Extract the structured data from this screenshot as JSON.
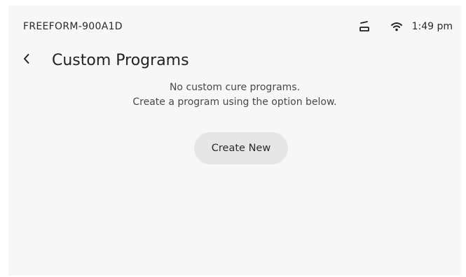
{
  "status_bar": {
    "device_name": "FREEFORM-900A1D",
    "time": "1:49 pm",
    "icons": [
      "tray-icon",
      "wifi-icon"
    ]
  },
  "header": {
    "back_icon": "chevron-left-icon",
    "title": "Custom Programs"
  },
  "empty_state": {
    "line1": "No custom cure programs.",
    "line2": "Create a program using the option below."
  },
  "actions": {
    "create_new_label": "Create New"
  },
  "colors": {
    "background": "#f7f7f7",
    "text": "#222222",
    "secondary_text": "#484848",
    "button_background": "#e6e6e6"
  }
}
